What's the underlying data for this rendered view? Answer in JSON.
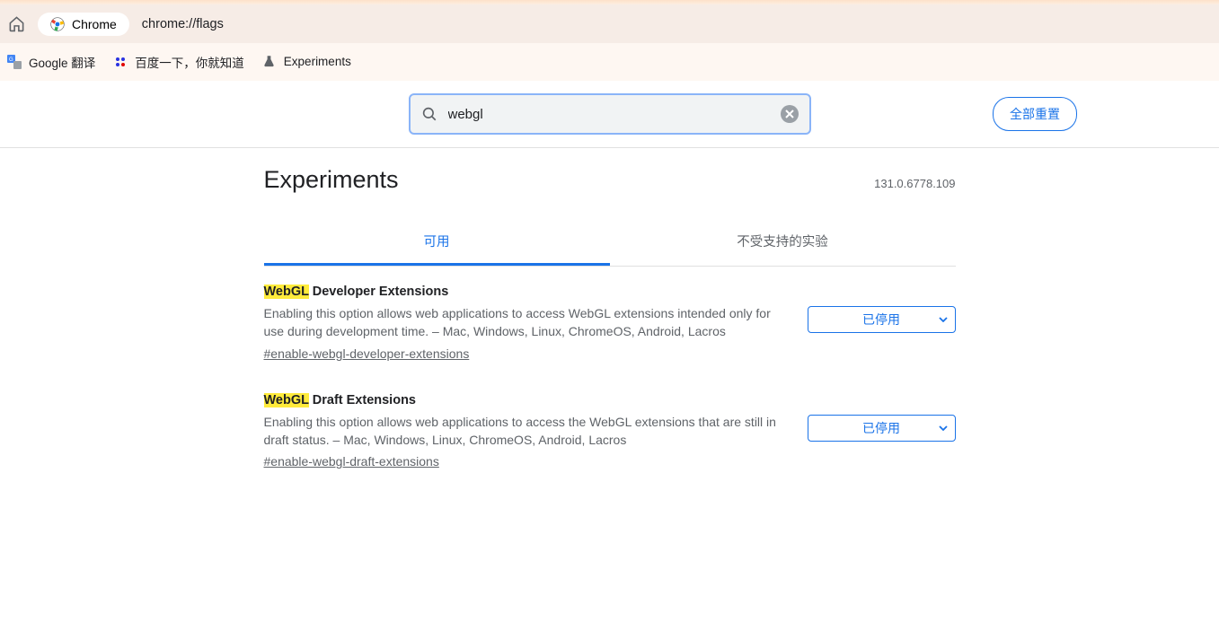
{
  "addressbar": {
    "chrome_label": "Chrome",
    "url": "chrome://flags"
  },
  "bookmarks": [
    {
      "label": "Google 翻译"
    },
    {
      "label": "百度一下，你就知道"
    },
    {
      "label": "Experiments"
    }
  ],
  "search": {
    "value": "webgl",
    "placeholder": ""
  },
  "reset_all": "全部重置",
  "heading": "Experiments",
  "version": "131.0.6778.109",
  "tabs": {
    "available": "可用",
    "unavailable": "不受支持的实验"
  },
  "flags": [
    {
      "title_hl": "WebGL",
      "title_rest": " Developer Extensions",
      "desc": "Enabling this option allows web applications to access WebGL extensions intended only for use during development time. – Mac, Windows, Linux, ChromeOS, Android, Lacros",
      "anchor": "#enable-webgl-developer-extensions",
      "select": "已停用"
    },
    {
      "title_hl": "WebGL",
      "title_rest": " Draft Extensions",
      "desc": "Enabling this option allows web applications to access the WebGL extensions that are still in draft status. – Mac, Windows, Linux, ChromeOS, Android, Lacros",
      "anchor": "#enable-webgl-draft-extensions",
      "select": "已停用"
    }
  ]
}
